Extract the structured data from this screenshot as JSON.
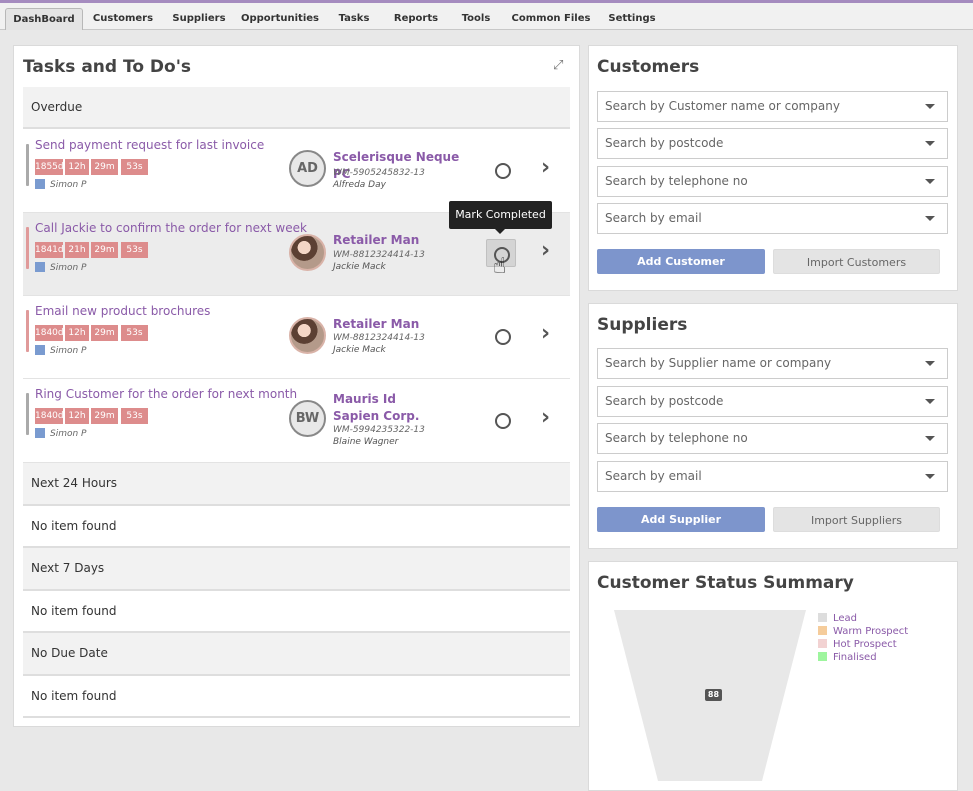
{
  "tabs": [
    "DashBoard",
    "Customers",
    "Suppliers",
    "Opportunities",
    "Tasks",
    "Reports",
    "Tools",
    "Common Files",
    "Settings"
  ],
  "tasks_panel": {
    "title": "Tasks and To Do's",
    "overdue_label": "Overdue",
    "tasks": [
      {
        "title": "Send payment request for last invoice",
        "days": "1855d",
        "hours": "12h",
        "mins": "29m",
        "secs": "53s",
        "owner": "Simon P",
        "avatar": "AD",
        "company": "Scelerisque Neque PC",
        "ref": "WM-5905245832-13",
        "person": "Alfreda Day",
        "bar_color": "#aaaaaa"
      },
      {
        "title": "Call Jackie to confirm the order for next week",
        "days": "1841d",
        "hours": "21h",
        "mins": "29m",
        "secs": "53s",
        "owner": "Simon P",
        "avatar": "",
        "company": "Retailer Man",
        "ref": "WM-8812324414-13",
        "person": "Jackie Mack",
        "bar_color": "#e09a9a"
      },
      {
        "title": "Email new product brochures",
        "days": "1840d",
        "hours": "12h",
        "mins": "29m",
        "secs": "53s",
        "owner": "Simon P",
        "avatar": "",
        "company": "Retailer Man",
        "ref": "WM-8812324414-13",
        "person": "Jackie Mack",
        "bar_color": "#e09a9a"
      },
      {
        "title": "Ring Customer for the order for next month",
        "days": "1840d",
        "hours": "12h",
        "mins": "29m",
        "secs": "53s",
        "owner": "Simon P",
        "avatar": "BW",
        "company": "Mauris Id Sapien Corp.",
        "ref": "WM-5994235322-13",
        "person": "Blaine Wagner",
        "bar_color": "#aaaaaa"
      }
    ],
    "tooltip": "Mark Completed",
    "sections": [
      {
        "label": "Next 24 Hours",
        "empty": "No item found"
      },
      {
        "label": "Next 7 Days",
        "empty": "No item found"
      },
      {
        "label": "No Due Date",
        "empty": "No item found"
      }
    ]
  },
  "customers_panel": {
    "title": "Customers",
    "search_name": "Search by Customer name or company",
    "search_postcode": "Search by postcode",
    "search_phone": "Search by telephone no",
    "search_email": "Search by email",
    "add_button": "Add Customer",
    "import_button": "Import Customers"
  },
  "suppliers_panel": {
    "title": "Suppliers",
    "search_name": "Search by Supplier name or company",
    "search_postcode": "Search by postcode",
    "search_phone": "Search by telephone no",
    "search_email": "Search by email",
    "add_button": "Add Supplier",
    "import_button": "Import Suppliers"
  },
  "status_panel": {
    "title": "Customer Status Summary",
    "legend": [
      {
        "label": "Lead",
        "color": "#dddddd"
      },
      {
        "label": "Warm Prospect",
        "color": "#f5cc9b"
      },
      {
        "label": "Hot Prospect",
        "color": "#f2d2d2"
      },
      {
        "label": "Finalised",
        "color": "#9ef59e"
      }
    ],
    "funnel_value": "88",
    "funnel_color": "#e8e8e8"
  }
}
